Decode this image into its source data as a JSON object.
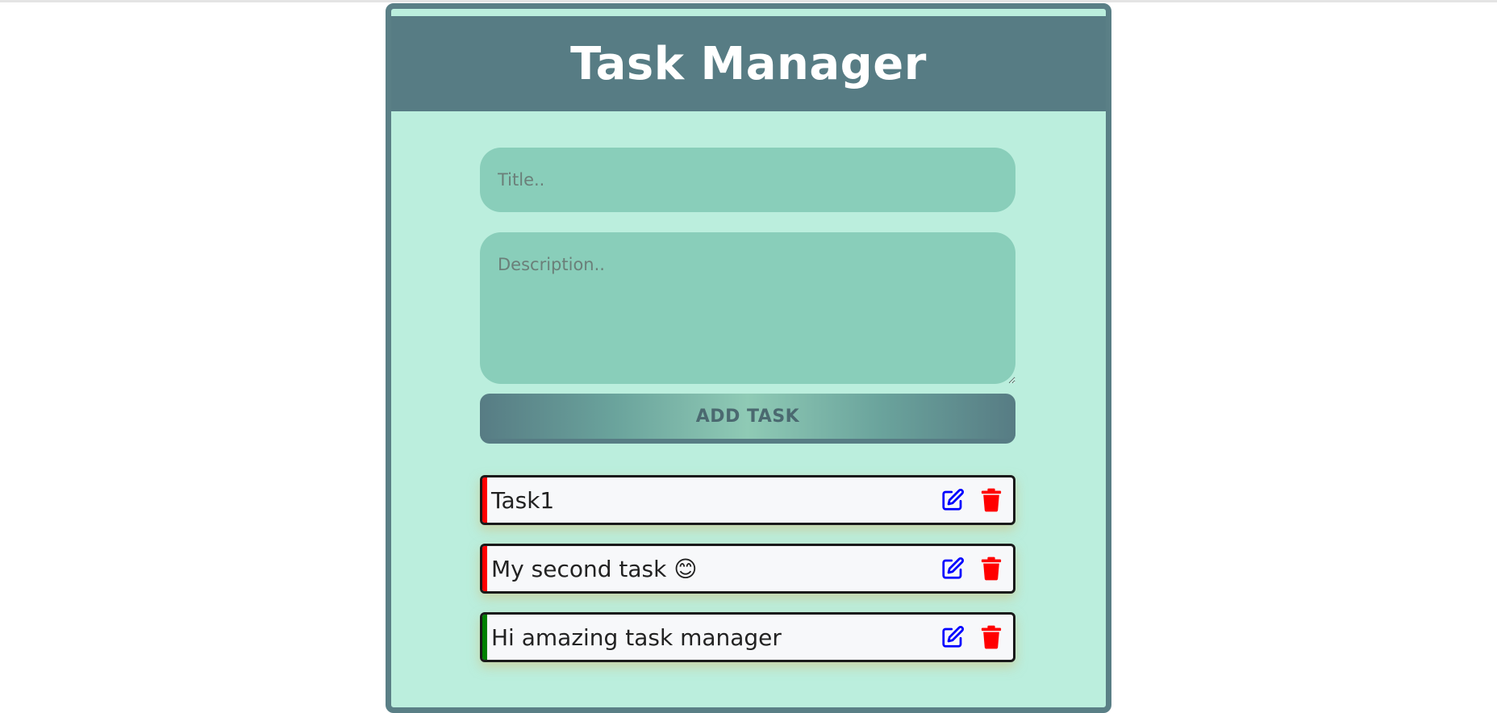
{
  "app": {
    "title": "Task Manager"
  },
  "form": {
    "title_placeholder": "Title..",
    "title_value": "",
    "description_placeholder": "Description..",
    "description_value": "",
    "add_button_label": "ADD TASK"
  },
  "tasks": [
    {
      "title": "Task1",
      "status_color": "#ff0000"
    },
    {
      "title": "My second task 😊",
      "status_color": "#ff0000"
    },
    {
      "title": "Hi amazing task manager",
      "status_color": "#008000"
    }
  ],
  "icons": {
    "edit": "edit-icon",
    "delete": "trash-icon"
  },
  "colors": {
    "header_bg": "#577c84",
    "panel_bg": "#bbeedd",
    "input_bg": "#89ceba",
    "edit_icon": "#0000ff",
    "delete_icon": "#ff0000"
  }
}
